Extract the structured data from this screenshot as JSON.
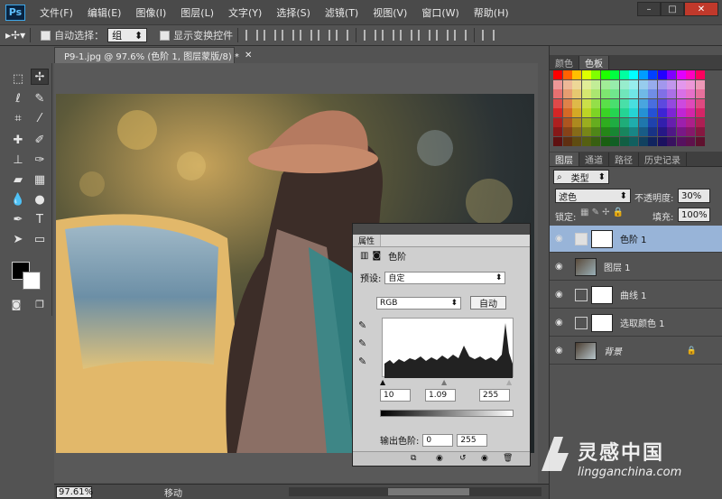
{
  "app": {
    "logo": "Ps"
  },
  "menu": [
    "文件(F)",
    "编辑(E)",
    "图像(I)",
    "图层(L)",
    "文字(Y)",
    "选择(S)",
    "滤镜(T)",
    "视图(V)",
    "窗口(W)",
    "帮助(H)"
  ],
  "options_bar": {
    "auto_select_label": "自动选择：",
    "auto_select_value": "组",
    "transform_label": "显示变换控件"
  },
  "document": {
    "tab_title": "P9-1.jpg @ 97.6% (色阶 1, 图层蒙版/8) *",
    "zoom": "97.61%",
    "status": "移动"
  },
  "color_panel": {
    "tabs": [
      "颜色",
      "色板"
    ],
    "active_tab": "色板"
  },
  "layers_panel": {
    "tabs": [
      "图层",
      "通道",
      "路径",
      "历史记录"
    ],
    "filter_label": "类型",
    "blend_mode": "滤色",
    "opacity_label": "不透明度:",
    "opacity_value": "30%",
    "lock_label": "锁定:",
    "fill_label": "填充:",
    "fill_value": "100%",
    "layers": [
      {
        "name": "色阶 1",
        "selected": true
      },
      {
        "name": "图层 1",
        "selected": false
      },
      {
        "name": "曲线 1",
        "selected": false
      },
      {
        "name": "选取颜色 1",
        "selected": false
      },
      {
        "name": "背景",
        "selected": false
      }
    ]
  },
  "properties_panel": {
    "tab": "属性",
    "title": "色阶",
    "preset_label": "预设:",
    "preset_value": "自定",
    "channel": "RGB",
    "auto_label": "自动",
    "input_black": "10",
    "input_gamma": "1.09",
    "input_white": "255",
    "output_label": "输出色阶:",
    "output_black": "0",
    "output_white": "255"
  },
  "watermark": {
    "brand": "灵感中国",
    "url": "lingganchina.com"
  }
}
